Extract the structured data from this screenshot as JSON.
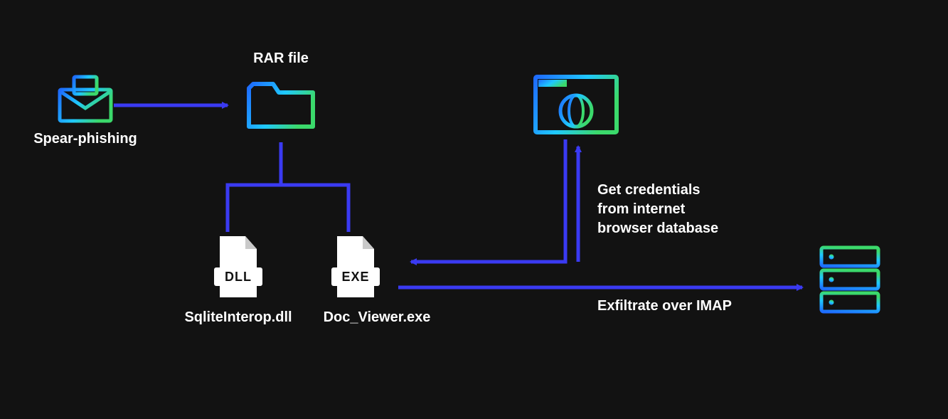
{
  "labels": {
    "spear": "Spear-phishing",
    "rar": "RAR file",
    "dll": "SqliteInterop.dll",
    "exe": "Doc_Viewer.exe",
    "dll_badge": "DLL",
    "exe_badge": "EXE"
  },
  "annotations": {
    "creds_line1": "Get credentials",
    "creds_line2": "from internet",
    "creds_line3": "browser database",
    "exfil": "Exfiltrate over IMAP"
  },
  "colors": {
    "arrow": "#3a3af2",
    "grad_blue": "#1e6bff",
    "grad_cyan": "#1fc8ff",
    "grad_green": "#3bd96b"
  }
}
